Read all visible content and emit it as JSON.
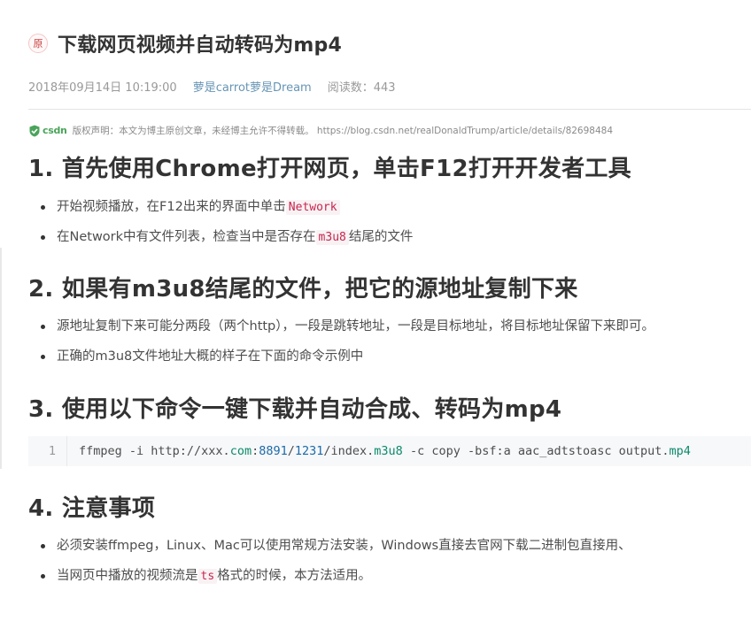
{
  "article": {
    "original_badge": "原",
    "title": "下载网页视频并自动转码为mp4",
    "date": "2018年09月14日 10:19:00",
    "author": "萝是carrot萝是Dream",
    "read_label": "阅读数：443"
  },
  "copyright": {
    "logo_text": "csdn",
    "text": "版权声明：本文为博主原创文章，未经博主允许不得转载。 https://blog.csdn.net/realDonaldTrump/article/details/82698484"
  },
  "sections": [
    {
      "heading": "1. 首先使用Chrome打开网页，单击F12打开开发者工具",
      "items": [
        {
          "pre": "开始视频播放，在F12出来的界面中单击",
          "code": "Network",
          "post": ""
        },
        {
          "pre": "在Network中有文件列表，检查当中是否存在",
          "code": "m3u8",
          "post": "结尾的文件"
        }
      ]
    },
    {
      "heading": "2. 如果有m3u8结尾的文件，把它的源地址复制下来",
      "items": [
        {
          "text": "源地址复制下来可能分两段（两个http），一段是跳转地址，一段是目标地址，将目标地址保留下来即可。"
        },
        {
          "text": "正确的m3u8文件地址大概的样子在下面的命令示例中"
        }
      ]
    },
    {
      "heading": "3. 使用以下命令一键下载并自动合成、转码为mp4",
      "code_line_number": "1",
      "code_parts": [
        "ffmpeg -i http://xxx.",
        "com",
        ":",
        "8891",
        "/",
        "1231",
        "/index.",
        "m3u8",
        " -c copy -bsf:a aac_adtstoasc output.",
        "mp4"
      ]
    },
    {
      "heading": "4. 注意事项",
      "items": [
        {
          "text": "必须安装ffmpeg，Linux、Mac可以使用常规方法安装，Windows直接去官网下载二进制包直接用、"
        },
        {
          "pre": "当网页中播放的视频流是",
          "code": "ts",
          "post": "格式的时候，本方法适用。"
        }
      ]
    }
  ]
}
